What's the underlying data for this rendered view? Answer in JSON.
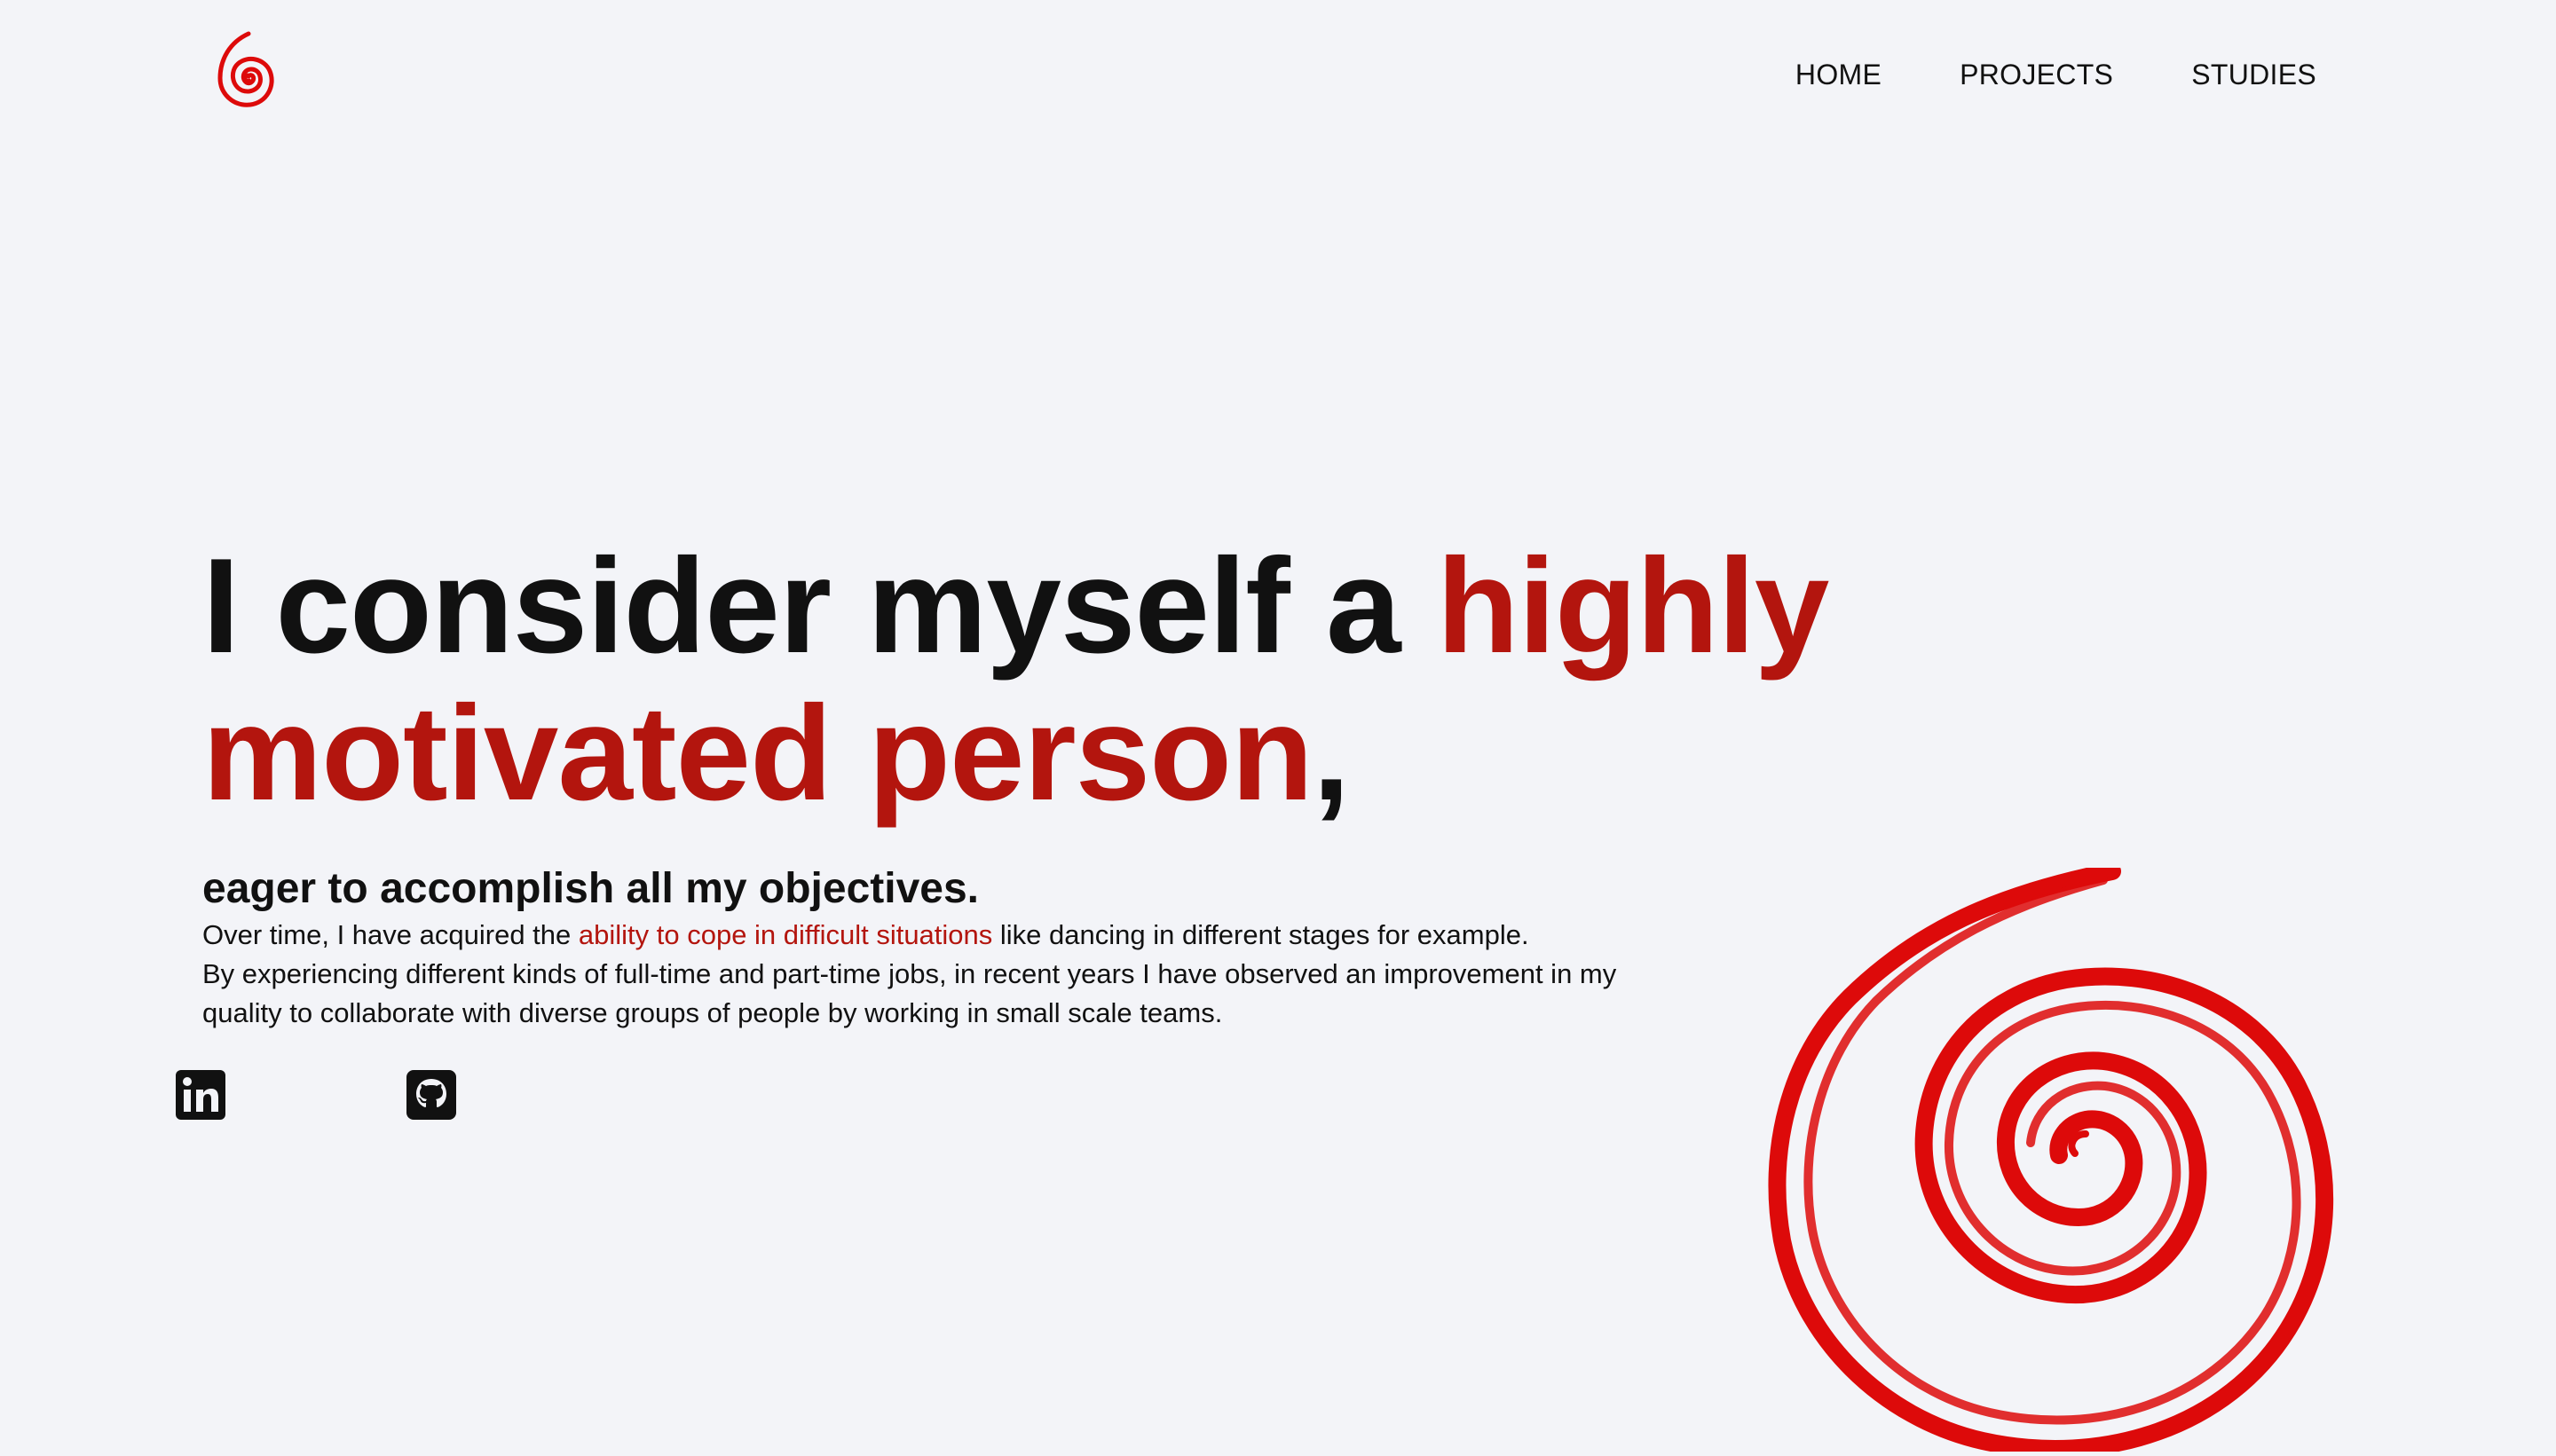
{
  "header": {
    "logo_icon": "red-spiral-icon",
    "nav": [
      {
        "label": "HOME"
      },
      {
        "label": "PROJECTS"
      },
      {
        "label": "STUDIES"
      }
    ]
  },
  "hero": {
    "line_start": "I consider myself a ",
    "line_accent": "highly motivated person",
    "line_end": ","
  },
  "intro": {
    "subhead": "eager to accomplish all my objectives.",
    "p1_before": "Over time, I have acquired the ",
    "p1_link": "ability to cope in difficult situations",
    "p1_after": " like dancing in different stages for example.",
    "p2": "By experiencing different kinds of full-time and part-time jobs, in recent years I have observed an improvement in my quality to collaborate with diverse groups of people by working in small scale teams."
  },
  "social": [
    {
      "icon": "linkedin-icon"
    },
    {
      "icon": "github-icon"
    }
  ],
  "decoration": {
    "icon": "red-spiral-icon"
  },
  "colors": {
    "background": "#f3f4f8",
    "accent": "#b3150e",
    "spiral": "#dd0a0a",
    "text": "#111111"
  }
}
